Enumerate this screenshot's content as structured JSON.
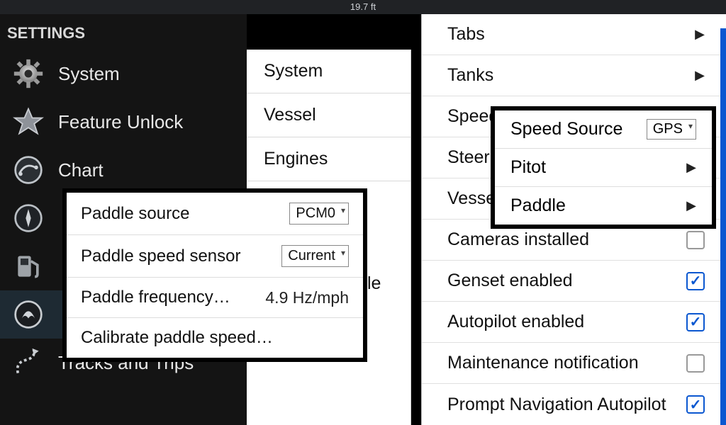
{
  "topbar": {
    "depth": "19.7 ft"
  },
  "sidebar": {
    "title": "SETTINGS",
    "items": [
      {
        "label": "System"
      },
      {
        "label": "Feature Unlock"
      },
      {
        "label": "Chart"
      },
      {
        "label": ""
      },
      {
        "label": ""
      },
      {
        "label": ""
      },
      {
        "label": "Tracks and Trips"
      }
    ]
  },
  "submenu": {
    "items": [
      {
        "label": "System"
      },
      {
        "label": "Vessel"
      },
      {
        "label": "Engines"
      }
    ],
    "peek_text": "le"
  },
  "detail": {
    "rows": [
      {
        "label": "Tabs",
        "kind": "arrow"
      },
      {
        "label": "Tanks",
        "kind": "arrow"
      },
      {
        "label": "Speed",
        "kind": "arrow_partial"
      },
      {
        "label": "Steer",
        "kind": "arrow_partial"
      },
      {
        "label": "Vesse",
        "kind": "arrow_partial"
      },
      {
        "label": "Cameras installed",
        "kind": "check",
        "checked": false
      },
      {
        "label": "Genset enabled",
        "kind": "check",
        "checked": true
      },
      {
        "label": "Autopilot enabled",
        "kind": "check",
        "checked": true
      },
      {
        "label": "Maintenance notification",
        "kind": "check",
        "checked": false
      },
      {
        "label": "Prompt Navigation Autopilot",
        "kind": "check",
        "checked": true
      }
    ]
  },
  "speed_popover": {
    "rows": [
      {
        "label": "Speed Source",
        "select": "GPS"
      },
      {
        "label": "Pitot",
        "arrow": true
      },
      {
        "label": "Paddle",
        "arrow": true
      }
    ]
  },
  "paddle_popover": {
    "rows": [
      {
        "label": "Paddle source",
        "select": "PCM0"
      },
      {
        "label": "Paddle speed sensor",
        "select": "Current"
      },
      {
        "label": "Paddle frequency…",
        "value": "4.9 Hz/mph"
      },
      {
        "label": "Calibrate paddle speed…"
      }
    ]
  }
}
